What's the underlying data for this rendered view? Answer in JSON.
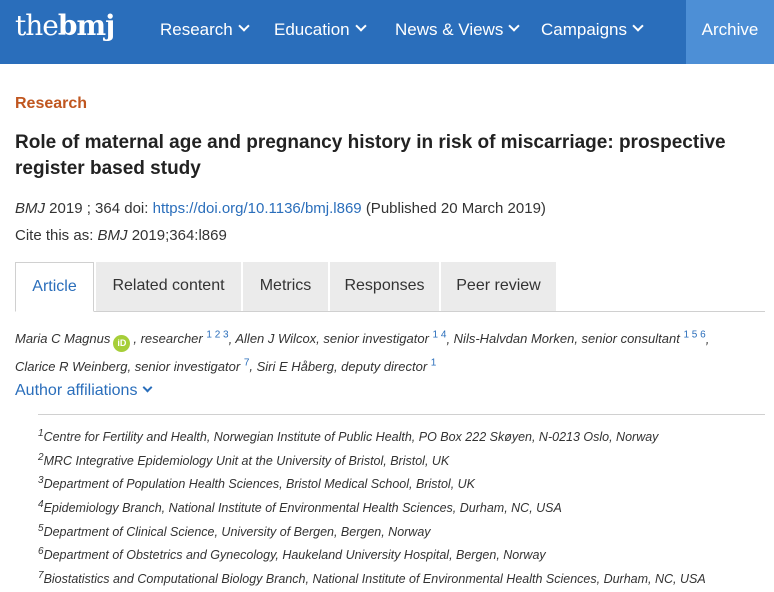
{
  "brand": {
    "logo_light": "the",
    "logo_bold": "bmj"
  },
  "nav": {
    "items": [
      "Research",
      "Education",
      "News & Views",
      "Campaigns"
    ],
    "archive": "Archive"
  },
  "article": {
    "section": "Research",
    "title": "Role of maternal age and pregnancy history in risk of miscarriage: prospective register based study",
    "journal": "BMJ",
    "year_vol": "2019  ; 364",
    "doi_label": "doi:",
    "doi_url": "https://doi.org/10.1136/bmj.l869",
    "published": "(Published 20 March 2019)",
    "cite_label": "Cite this as:",
    "cite_journal": "BMJ",
    "cite_ref": "2019;364:l869"
  },
  "tabs": [
    "Article",
    "Related content",
    "Metrics",
    "Responses",
    "Peer review"
  ],
  "authors": [
    {
      "name": "Maria C Magnus",
      "orcid": "iD",
      "role": ", researcher",
      "aff": "1 2 3"
    },
    {
      "name": "Allen J Wilcox",
      "role": ", senior investigator",
      "aff": "1 4"
    },
    {
      "name": "Nils-Halvdan Morken",
      "role": ", senior consultant",
      "aff": "1 5 6"
    },
    {
      "name": "Clarice R Weinberg",
      "role": ", senior investigator",
      "aff": "7"
    },
    {
      "name": "Siri E Håberg",
      "role": ", deputy director",
      "aff": "1"
    }
  ],
  "affiliations_toggle": "Author affiliations",
  "affiliations": [
    {
      "n": "1",
      "text": "Centre for Fertility and Health, Norwegian Institute of Public Health, PO Box 222 Skøyen, N-0213 Oslo, Norway"
    },
    {
      "n": "2",
      "text": "MRC Integrative Epidemiology Unit at the University of Bristol, Bristol, UK"
    },
    {
      "n": "3",
      "text": "Department of Population Health Sciences, Bristol Medical School, Bristol, UK"
    },
    {
      "n": "4",
      "text": "Epidemiology Branch, National Institute of Environmental Health Sciences, Durham, NC, USA"
    },
    {
      "n": "5",
      "text": "Department of Clinical Science, University of Bergen, Bergen, Norway"
    },
    {
      "n": "6",
      "text": "Department of Obstetrics and Gynecology, Haukeland University Hospital, Bergen, Norway"
    },
    {
      "n": "7",
      "text": "Biostatistics and Computational Biology Branch, National Institute of Environmental Health Sciences, Durham, NC, USA"
    }
  ],
  "colors": {
    "brand_blue": "#2a6ebb",
    "archive_bg": "#4d8fd6",
    "section_orange": "#c0561f",
    "orcid_green": "#a6ce39"
  }
}
